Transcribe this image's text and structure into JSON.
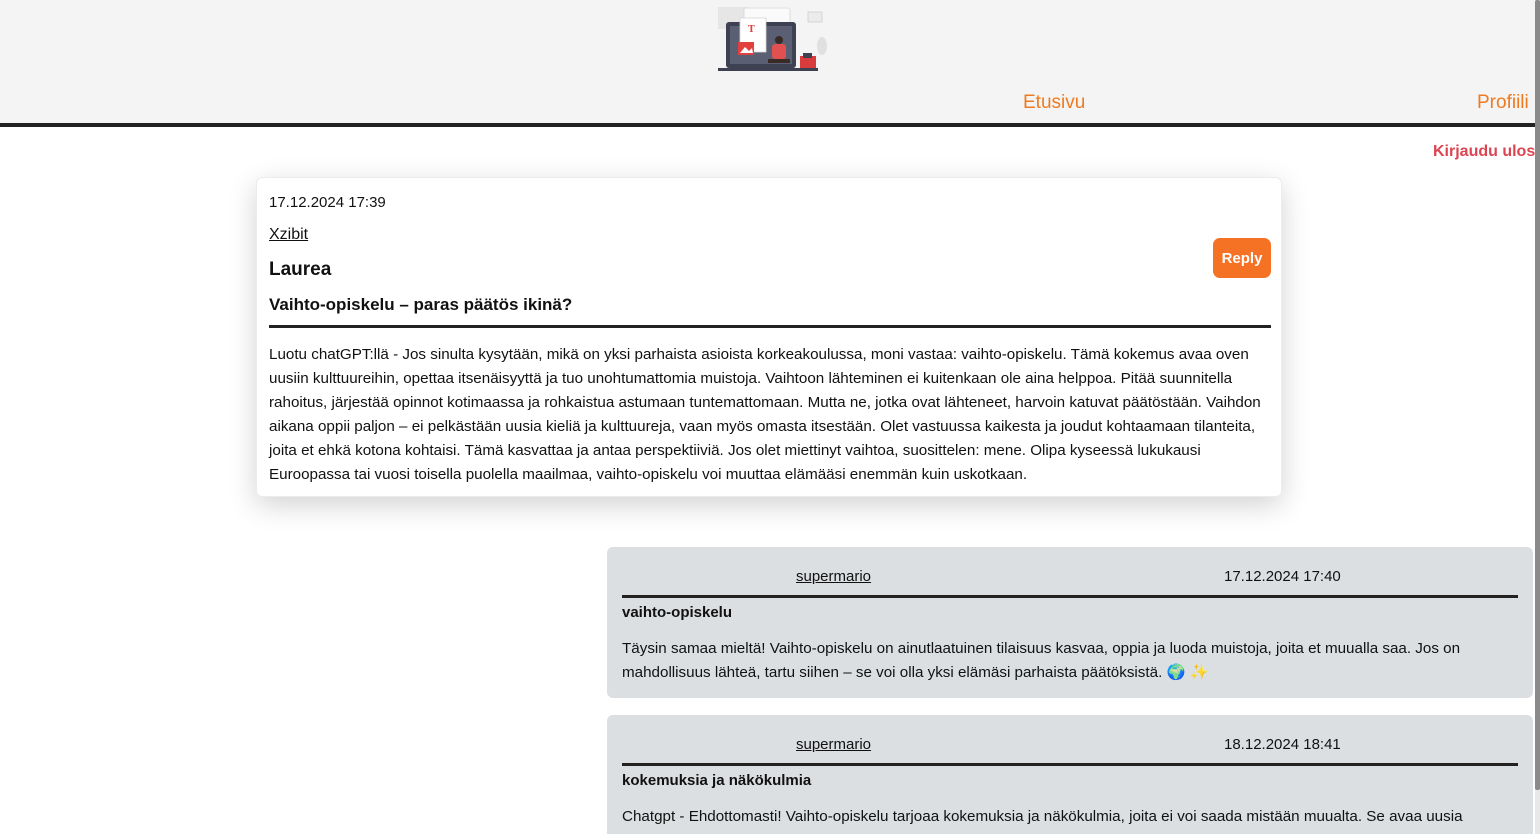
{
  "nav": {
    "home_label": "Etusivu",
    "profile_label": "Profiili",
    "logout_label": "Kirjaudu ulos"
  },
  "post": {
    "date": "17.12.2024 17:39",
    "author": "Xzibit",
    "school": "Laurea",
    "title": "Vaihto-opiskelu – paras päätös ikinä?",
    "body": "Luotu chatGPT:llä - Jos sinulta kysytään, mikä on yksi parhaista asioista korkeakoulussa, moni vastaa: vaihto-opiskelu. Tämä kokemus avaa oven uusiin kulttuureihin, opettaa itsenäisyyttä ja tuo unohtumattomia muistoja. Vaihtoon lähteminen ei kuitenkaan ole aina helppoa. Pitää suunnitella rahoitus, järjestää opinnot kotimaassa ja rohkaistua astumaan tuntemattomaan. Mutta ne, jotka ovat lähteneet, harvoin katuvat päätöstään. Vaihdon aikana oppii paljon – ei pelkästään uusia kieliä ja kulttuureja, vaan myös omasta itsestään. Olet vastuussa kaikesta ja joudut kohtaamaan tilanteita, joita et ehkä kotona kohtaisi. Tämä kasvattaa ja antaa perspektiiviä. Jos olet miettinyt vaihtoa, suosittelen: mene. Olipa kyseessä lukukausi Euroopassa tai vuosi toisella puolella maailmaa, vaihto-opiskelu voi muuttaa elämääsi enemmän kuin uskotkaan.",
    "reply_label": "Reply"
  },
  "comments": [
    {
      "user": "supermario",
      "date": "17.12.2024 17:40",
      "title": "vaihto-opiskelu",
      "body": "Täysin samaa mieltä! Vaihto-opiskelu on ainutlaatuinen tilaisuus kasvaa, oppia ja luoda muistoja, joita et muualla saa. Jos on mahdollisuus lähteä, tartu siihen – se voi olla yksi elämäsi parhaista päätöksistä. 🌍 ✨"
    },
    {
      "user": "supermario",
      "date": "18.12.2024 18:41",
      "title": "kokemuksia ja näkökulmia",
      "body": "Chatgpt - Ehdottomasti! Vaihto-opiskelu tarjoaa kokemuksia ja näkökulmia, joita ei voi saada mistään muualta. Se avaa uusia"
    }
  ],
  "colors": {
    "accent": "#f57224",
    "nav_link": "#f07a1f",
    "logout": "#dd4452",
    "comment_bg": "#dcdfe2",
    "header_bg": "#f4f4f5"
  }
}
